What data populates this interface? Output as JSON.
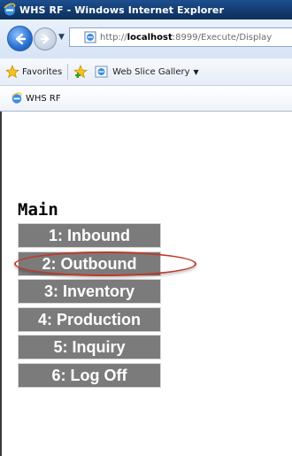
{
  "window": {
    "title": "WHS RF - Windows Internet Explorer"
  },
  "address_bar": {
    "url_prefix": "http://",
    "url_host": "localhost",
    "url_rest": ":8999/Execute/Display"
  },
  "favorites_bar": {
    "favorites_label": "Favorites",
    "web_slice_label": "Web Slice Gallery"
  },
  "tab": {
    "label": "WHS RF"
  },
  "page": {
    "heading": "Main",
    "menu_items": [
      {
        "label": "1: Inbound"
      },
      {
        "label": "2: Outbound"
      },
      {
        "label": "3: Inventory"
      },
      {
        "label": "4: Production"
      },
      {
        "label": "5: Inquiry"
      },
      {
        "label": "6: Log Off"
      }
    ],
    "highlighted_item_index": 1,
    "highlight_color": "#c0392b"
  },
  "colors": {
    "menu_button_bg": "#7b7b7b",
    "title_bar": "#123a6e"
  }
}
